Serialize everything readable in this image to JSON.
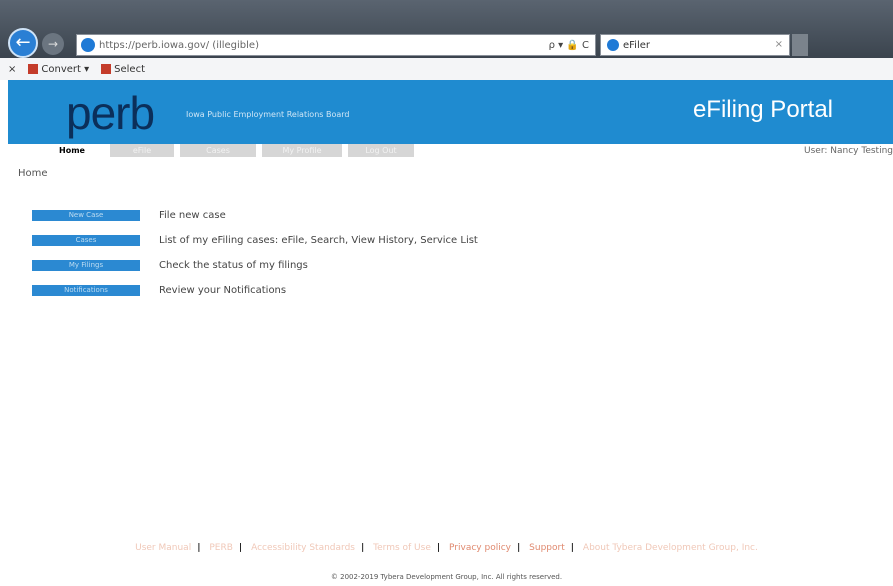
{
  "browser": {
    "address_url": "https://perb.iowa.gov/ (illegible)",
    "address_controls": "ρ ▾ 🔒 C",
    "tab_title": "eFiler",
    "toolbar": {
      "convert_label": "Convert ▾",
      "select_label": "Select"
    }
  },
  "banner": {
    "logo": "perb",
    "tagline": "Iowa Public Employment Relations Board",
    "portal_title": "eFiling Portal"
  },
  "nav": {
    "tabs": [
      {
        "label": "Home"
      },
      {
        "label": "eFile"
      },
      {
        "label": "Cases"
      },
      {
        "label": "My Profile"
      },
      {
        "label": "Log Out"
      }
    ],
    "user": "User: Nancy Testing"
  },
  "breadcrumb": "Home",
  "actions": [
    {
      "button": "New Case",
      "description": "File new case"
    },
    {
      "button": "Cases",
      "description": "List of my eFiling cases: eFile, Search, View History, Service List"
    },
    {
      "button": "My Filings",
      "description": "Check the status of my filings"
    },
    {
      "button": "Notifications",
      "description": "Review your Notifications"
    }
  ],
  "footer": {
    "links": [
      {
        "label": "User Manual",
        "style": "faint"
      },
      {
        "label": "PERB",
        "style": "faint"
      },
      {
        "label": "Accessibility Standards",
        "style": "faint"
      },
      {
        "label": "Terms of Use",
        "style": "faint"
      },
      {
        "label": "Privacy policy",
        "style": "link"
      },
      {
        "label": "Support",
        "style": "link"
      },
      {
        "label": "About Tybera Development Group, Inc.",
        "style": "faint"
      }
    ],
    "copyright": "© 2002-2019 Tybera Development Group, Inc. All rights reserved."
  },
  "colors": {
    "banner": "#1f8bd0",
    "logo": "#0b2f5a",
    "button": "#2b89d2"
  }
}
